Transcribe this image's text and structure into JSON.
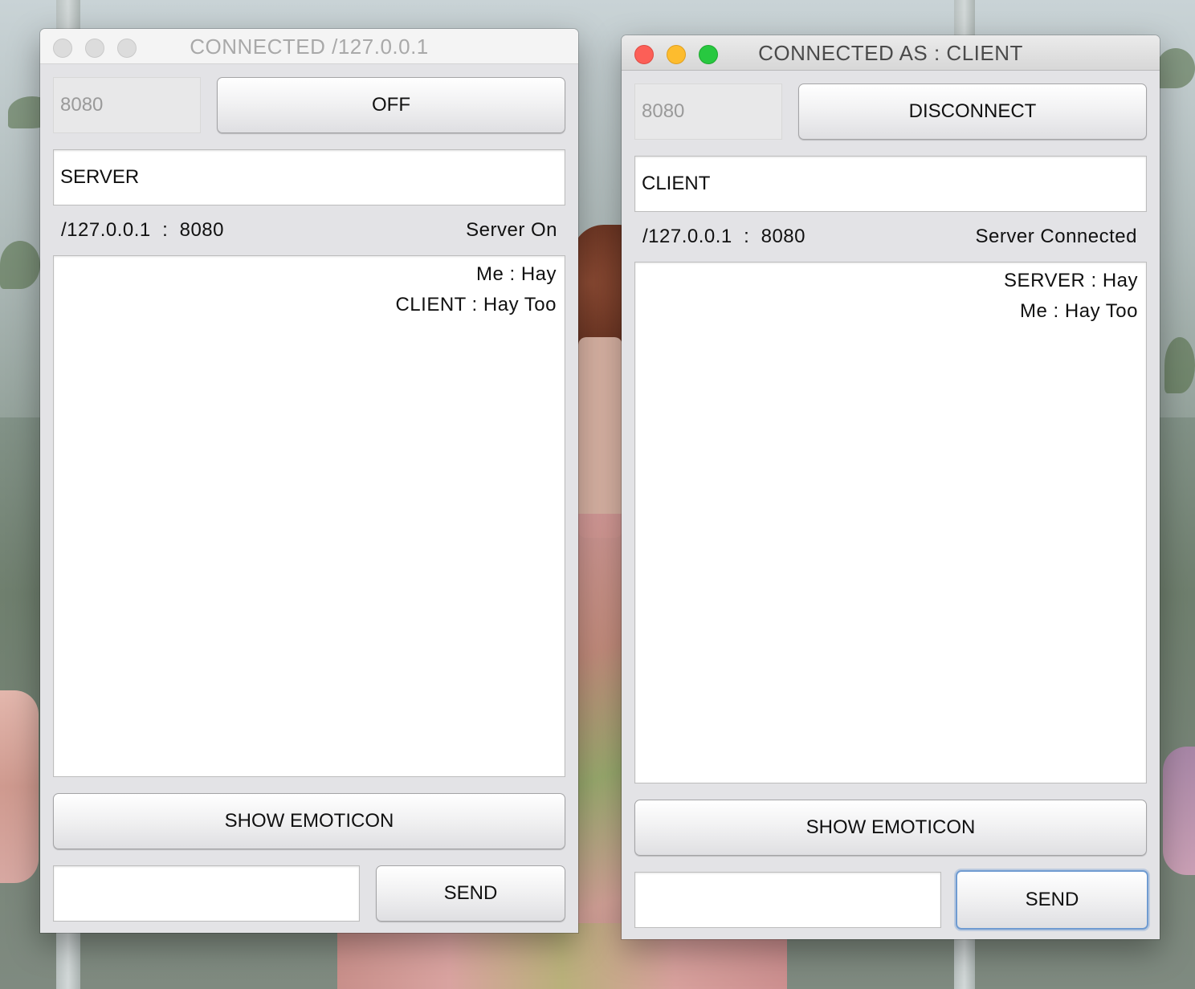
{
  "server_window": {
    "title": "CONNECTED /127.0.0.1",
    "port_value": "8080",
    "toggle_button_label": "OFF",
    "name_value": "SERVER",
    "address_label": "/127.0.0.1  :  8080",
    "status_label": "Server On",
    "messages": [
      {
        "text": "Me  :  Hay"
      },
      {
        "text": "CLIENT  :  Hay Too"
      }
    ],
    "emoticon_button_label": "SHOW EMOTICON",
    "message_input_value": "",
    "send_button_label": "SEND"
  },
  "client_window": {
    "title": "CONNECTED AS : CLIENT",
    "port_value": "8080",
    "toggle_button_label": "DISCONNECT",
    "name_value": "CLIENT",
    "address_label": "/127.0.0.1  :  8080",
    "status_label": "Server Connected",
    "messages": [
      {
        "text": "SERVER  :  Hay"
      },
      {
        "text": "Me  :  Hay Too"
      }
    ],
    "emoticon_button_label": "SHOW EMOTICON",
    "message_input_value": "",
    "send_button_label": "SEND"
  },
  "colors": {
    "traffic_red": "#fc5f57",
    "traffic_yellow": "#fdbc2e",
    "traffic_green": "#28c840",
    "focus_ring": "#6f9bd1"
  }
}
